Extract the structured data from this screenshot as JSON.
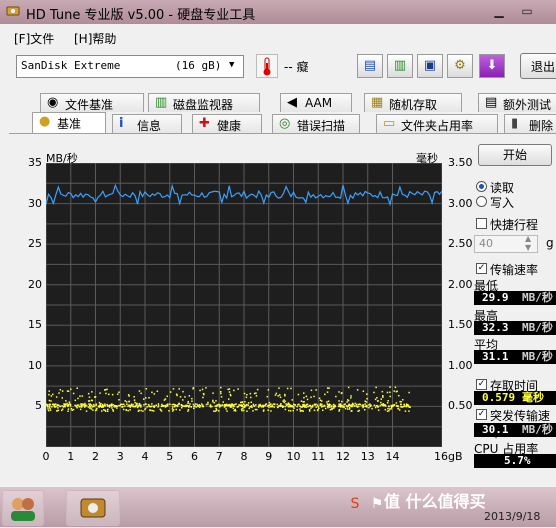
{
  "window": {
    "title": "HD Tune 专业版 v5.00 - 硬盘专业工具",
    "min_glyph": "▁",
    "max_glyph": "▭"
  },
  "menu": {
    "file": "[F]文件",
    "help": "[H]帮助"
  },
  "toolbar": {
    "drive_name": "SanDisk Extreme",
    "drive_size": "(16 gB)",
    "temperature": "-- 癡",
    "exit_label": "退出",
    "buttons": [
      {
        "icon": "copy-info-icon",
        "glyph": "▤"
      },
      {
        "icon": "copy-screenshot-icon",
        "glyph": "▥"
      },
      {
        "icon": "save-icon",
        "glyph": "▣"
      },
      {
        "icon": "options-icon",
        "glyph": "⚙"
      },
      {
        "icon": "download-icon",
        "glyph": "⬇"
      }
    ]
  },
  "tabs_top": [
    {
      "label": "文件基准",
      "icon": "file-benchmark-icon",
      "glyph": "◉"
    },
    {
      "label": "磁盘监视器",
      "icon": "disk-monitor-icon",
      "glyph": "▥"
    },
    {
      "label": "AAM",
      "icon": "speaker-icon",
      "glyph": "◀"
    },
    {
      "label": "随机存取",
      "icon": "random-access-icon",
      "glyph": "▦"
    },
    {
      "label": "额外测试",
      "icon": "extra-tests-icon",
      "glyph": "▤"
    }
  ],
  "tabs_bottom": [
    {
      "label": "基准",
      "icon": "benchmark-icon",
      "glyph": "●"
    },
    {
      "label": "信息",
      "icon": "info-icon",
      "glyph": "i"
    },
    {
      "label": "健康",
      "icon": "health-icon",
      "glyph": "✚"
    },
    {
      "label": "错误扫描",
      "icon": "error-scan-icon",
      "glyph": "◎"
    },
    {
      "label": "文件夹占用率",
      "icon": "folder-usage-icon",
      "glyph": "▭"
    },
    {
      "label": "删除",
      "icon": "erase-icon",
      "glyph": "▮"
    }
  ],
  "chart_data": {
    "type": "line",
    "left_unit": "MB/秒",
    "right_unit": "毫秒",
    "left_ticks": [
      "35",
      "30",
      "25",
      "20",
      "15",
      "10",
      "5"
    ],
    "right_ticks": [
      "3.50",
      "3.00",
      "2.50",
      "2.00",
      "1.50",
      "1.00",
      "0.50"
    ],
    "x_ticks": [
      "0",
      "1",
      "2",
      "3",
      "4",
      "5",
      "6",
      "7",
      "8",
      "9",
      "10",
      "11",
      "12",
      "13",
      "14",
      "16gB"
    ],
    "ylim": [
      0,
      35
    ],
    "ylim_right": [
      0,
      3.5
    ],
    "xlim": [
      0,
      16
    ],
    "series": [
      {
        "name": "读取",
        "kind": "line",
        "color": "#3aa0ff",
        "mean": 31.1,
        "min": 29.9,
        "max": 32.3
      },
      {
        "name": "存取时间",
        "kind": "scatter",
        "color": "#ffff40",
        "mean_ms": 0.579,
        "range_ms": [
          0.45,
          0.75
        ]
      }
    ]
  },
  "panel": {
    "start_label": "开始",
    "radio_read": "读取",
    "radio_write": "写入",
    "quick_course": "快捷行程",
    "quick_value": "40",
    "gb_suffix": "g",
    "transfer_rate": "传输速率",
    "min_label": "最低",
    "min_value": "29.9",
    "min_unit": "MB/秒",
    "max_label": "最高",
    "max_value": "32.3",
    "max_unit": "MB/秒",
    "avg_label": "平均",
    "avg_value": "31.1",
    "avg_unit": "MB/秒",
    "access_time": "存取时间",
    "access_value": "0.579",
    "access_unit": "毫秒",
    "burst_rate": "突发传输速率",
    "burst_value": "30.1",
    "burst_unit": "MB/秒",
    "cpu_label": "CPU 占用率",
    "cpu_value": "5.7%"
  },
  "taskbar": {
    "clock_date": "2013/9/18",
    "icons": [
      "users-icon",
      "hdtune-app-icon"
    ],
    "tray": [
      "sogou-icon",
      "flag-icon"
    ]
  }
}
